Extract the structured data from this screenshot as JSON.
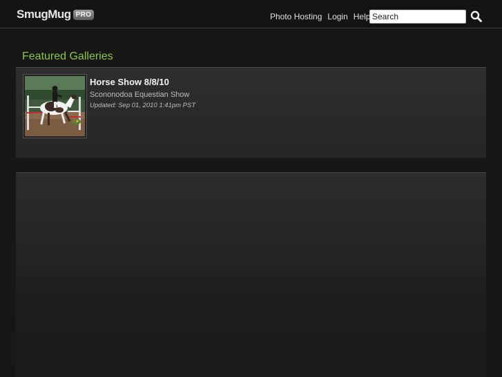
{
  "header": {
    "logo_text": "SmugMug",
    "logo_badge": "PRO",
    "nav": [
      "Photo Hosting",
      "Login",
      "Help"
    ],
    "search": {
      "value": "Search",
      "placeholder": "Search"
    },
    "search_icon": "search-icon"
  },
  "featured": {
    "title": "Featured Galleries",
    "galleries": [
      {
        "title": "Horse Show 8/8/10",
        "description": "Scononodoa Equestian Show",
        "updated": "Updated: Sep 01, 2010 1:41pm PST"
      }
    ]
  },
  "colors": {
    "accent": "#8dc63f",
    "background": "#171717",
    "panel": "#2b2b2b"
  }
}
